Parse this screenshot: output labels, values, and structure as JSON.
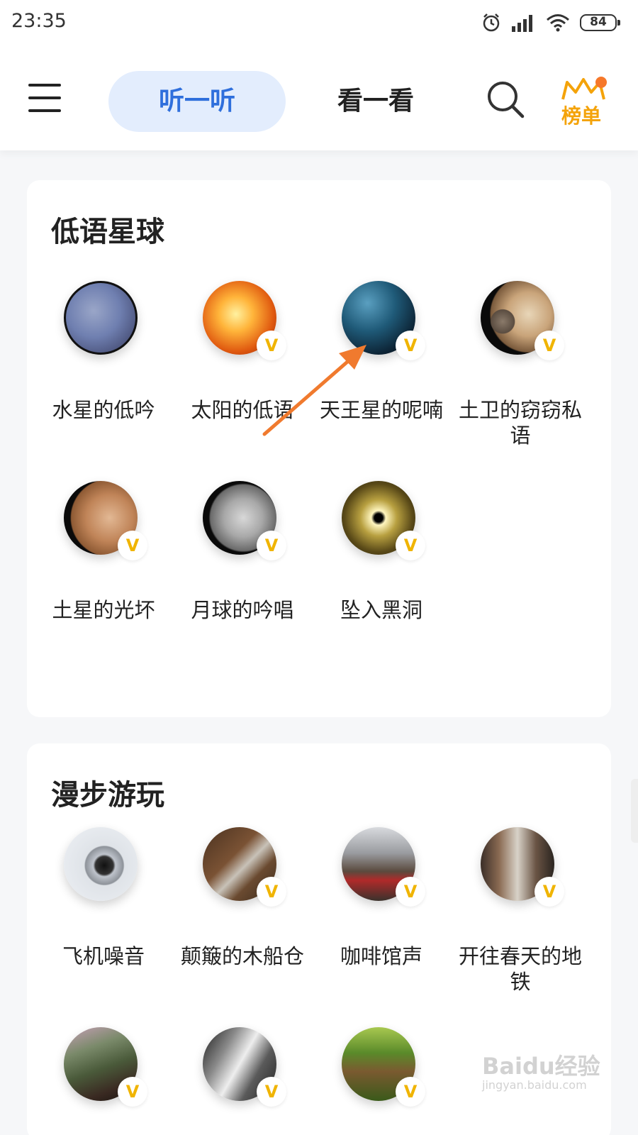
{
  "status_bar": {
    "time": "23:35",
    "battery": "84",
    "icons": [
      "alarm-icon",
      "signal-icon",
      "wifi-icon",
      "battery-icon"
    ]
  },
  "header": {
    "menu_icon": "menu-icon",
    "tabs": [
      {
        "label": "听一听",
        "active": true
      },
      {
        "label": "看一看",
        "active": false
      }
    ],
    "search_icon": "search-icon",
    "rank_label": "榜单",
    "rank_badge": true
  },
  "sections": [
    {
      "title": "低语星球",
      "items": [
        {
          "label": "水星的低吟",
          "icon": "mercury-image",
          "vip": false
        },
        {
          "label": "太阳的低语",
          "icon": "sun-image",
          "vip": true
        },
        {
          "label": "天王星的呢喃",
          "icon": "uranus-image",
          "vip": true
        },
        {
          "label": "土卫的窃窃私语",
          "icon": "saturn-moon-image",
          "vip": true
        },
        {
          "label": "土星的光坏",
          "icon": "saturn-ring-image",
          "vip": true
        },
        {
          "label": "月球的吟唱",
          "icon": "moon-image",
          "vip": true
        },
        {
          "label": "坠入黑洞",
          "icon": "black-hole-image",
          "vip": true
        }
      ]
    },
    {
      "title": "漫步游玩",
      "items": [
        {
          "label": "飞机噪音",
          "icon": "airplane-image",
          "vip": false
        },
        {
          "label": "颠簸的木船仓",
          "icon": "boat-image",
          "vip": true
        },
        {
          "label": "咖啡馆声",
          "icon": "cafe-image",
          "vip": true
        },
        {
          "label": "开往春天的地铁",
          "icon": "subway-image",
          "vip": true
        },
        {
          "label": "",
          "icon": "train-image",
          "vip": true
        },
        {
          "label": "",
          "icon": "rail-image",
          "vip": true
        },
        {
          "label": "",
          "icon": "forest-image",
          "vip": true
        }
      ]
    }
  ],
  "vip_label": "V",
  "colors": {
    "accent": "#2f6fdc",
    "tab_bg": "#e3edfd",
    "rank": "#f4a30a",
    "vip": "#f0b400",
    "arrow": "#f07a2e"
  },
  "watermark": {
    "text": "Baidu经验",
    "sub": "jingyan.baidu.com"
  }
}
